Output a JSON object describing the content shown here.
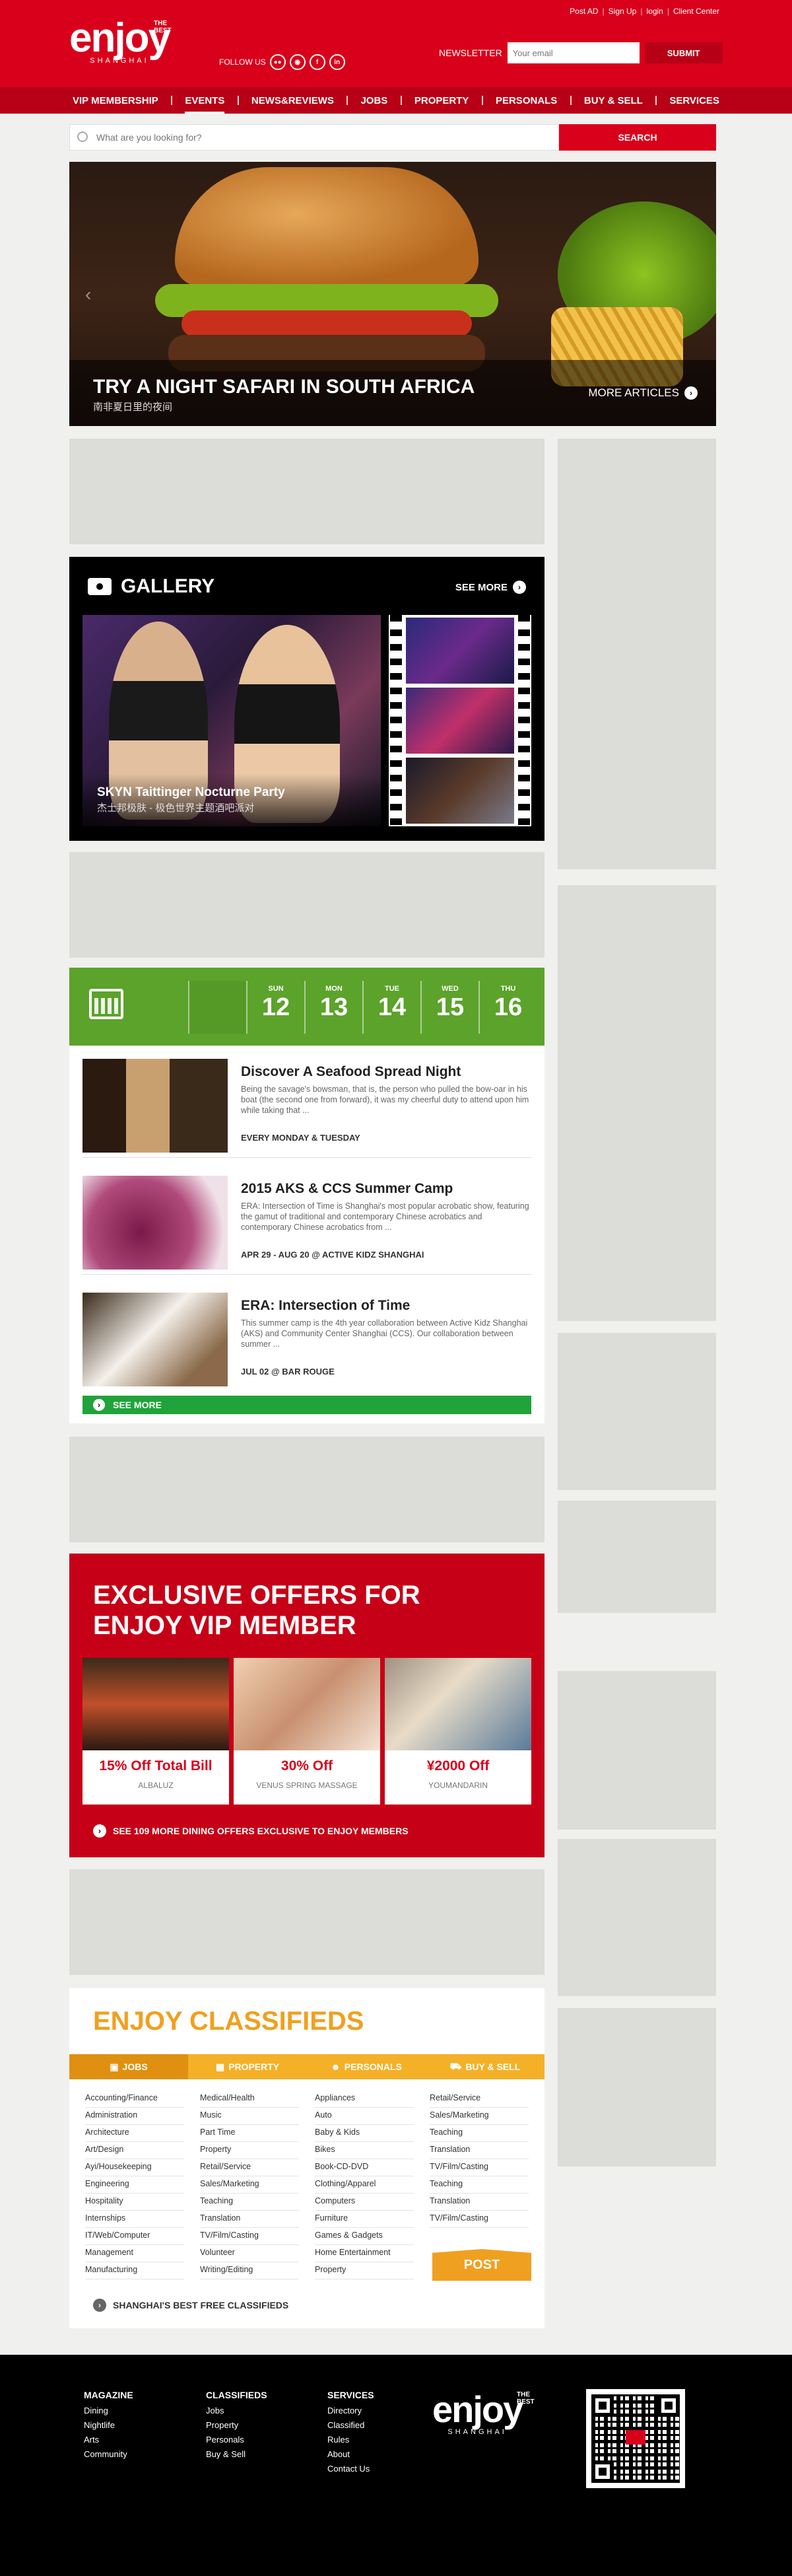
{
  "topbar": {
    "post_ad": "Post AD",
    "signup": "Sign Up",
    "login": "login",
    "client_center": "Client Center",
    "sep": "|"
  },
  "logo": {
    "word": "enjoy",
    "tagline": "THE BEST",
    "city": "SHANGHAI"
  },
  "follow": {
    "label": "FOLLOW US"
  },
  "newsletter": {
    "label": "NEWSLETTER",
    "placeholder": "Your email",
    "submit": "SUBMIT"
  },
  "nav": {
    "items": [
      "VIP MEMBERSHIP",
      "EVENTS",
      "NEWS&REVIEWS",
      "JOBS",
      "PROPERTY",
      "PERSONALS",
      "BUY & SELL",
      "SERVICES"
    ],
    "active": "EVENTS"
  },
  "search": {
    "placeholder": "What are you looking for?",
    "button": "SEARCH"
  },
  "hero": {
    "title": "TRY A NIGHT SAFARI IN SOUTH AFRICA",
    "subtitle": "南非夏日里的夜间",
    "more": "MORE ARTICLES"
  },
  "gallery": {
    "title": "GALLERY",
    "see_more": "SEE MORE",
    "main_title": "SKYN Taittinger Nocturne Party",
    "main_subtitle": "杰士邦极肤 - 极色世界主题酒吧派对"
  },
  "events": {
    "days": [
      {
        "name": "SUN",
        "date": "12"
      },
      {
        "name": "MON",
        "date": "13"
      },
      {
        "name": "TUE",
        "date": "14"
      },
      {
        "name": "WED",
        "date": "15"
      },
      {
        "name": "THU",
        "date": "16"
      }
    ],
    "items": [
      {
        "title": "Discover A Seafood Spread Night",
        "desc": "Being the savage's bowsman, that is, the person who pulled the bow-oar in his boat (the second one from forward), it was my cheerful duty to attend upon him while taking that ...",
        "when": "EVERY MONDAY & TUESDAY"
      },
      {
        "title": "2015 AKS & CCS Summer Camp",
        "desc": "ERA: Intersection of Time is Shanghai's most popular acrobatic show, featuring the gamut of traditional and contemporary Chinese acrobatics and contemporary Chinese acrobatics from ...",
        "when": "APR 29 - AUG 20 @ ACTIVE KIDZ SHANGHAI"
      },
      {
        "title": "ERA: Intersection of Time",
        "desc": "This summer camp is the 4th year collaboration between Active Kidz Shanghai (AKS) and Community Center Shanghai (CCS). Our collaboration between summer ...",
        "when": "JUL 02 @ BAR ROUGE"
      }
    ],
    "see_more": "SEE MORE"
  },
  "offers": {
    "title_line1": "EXCLUSIVE OFFERS FOR",
    "title_line2": "ENJOY VIP MEMBER",
    "items": [
      {
        "price": "15% Off Total Bill",
        "name": "ALBALUZ"
      },
      {
        "price": "30% Off",
        "name": "VENUS SPRING MASSAGE"
      },
      {
        "price": "¥2000 Off",
        "name": "YOUMANDARIN"
      }
    ],
    "footer": "SEE 109 MORE DINING OFFERS EXCLUSIVE TO ENJOY MEMBERS"
  },
  "classifieds": {
    "title": "ENJOY CLASSIFIEDS",
    "tabs": [
      "JOBS",
      "PROPERTY",
      "PERSONALS",
      "BUY & SELL"
    ],
    "col1": [
      "Accounting/Finance",
      "Administration",
      "Architecture",
      "Art/Design",
      "Ayi/Housekeeping",
      "Engineering",
      "Hospitality",
      "Internships",
      "IT/Web/Computer",
      "Management",
      "Manufacturing"
    ],
    "col2": [
      "Medical/Health",
      "Music",
      "Part Time",
      "Property",
      "Retail/Service",
      "Sales/Marketing",
      "Teaching",
      "Translation",
      "TV/Film/Casting",
      "Volunteer",
      "Writing/Editing"
    ],
    "col3": [
      "Appliances",
      "Auto",
      "Baby & Kids",
      "Bikes",
      "Book-CD-DVD",
      "Clothing/Apparel",
      "Computers",
      "Furniture",
      "Games & Gadgets",
      "Home Entertainment",
      "Property"
    ],
    "col4": [
      "Retail/Service",
      "Sales/Marketing",
      "Teaching",
      "Translation",
      "TV/Film/Casting",
      "Teaching",
      "Translation",
      "TV/Film/Casting"
    ],
    "post": "POST",
    "footer": "SHANGHAI'S BEST FREE CLASSIFIEDS"
  },
  "footer": {
    "magazine": {
      "heading": "MAGAZINE",
      "links": [
        "Dining",
        "Nightlife",
        "Arts",
        "Community"
      ]
    },
    "classifieds": {
      "heading": "CLASSIFIEDS",
      "links": [
        "Jobs",
        "Property",
        "Personals",
        "Buy & Sell"
      ]
    },
    "services": {
      "heading": "SERVICES",
      "links": [
        "Directory",
        "Classified",
        "Rules",
        "About",
        "Contact Us"
      ]
    }
  },
  "colors": {
    "brand_red": "#d9001b",
    "events_green": "#5ba32a",
    "classifieds_orange": "#f0a020"
  }
}
